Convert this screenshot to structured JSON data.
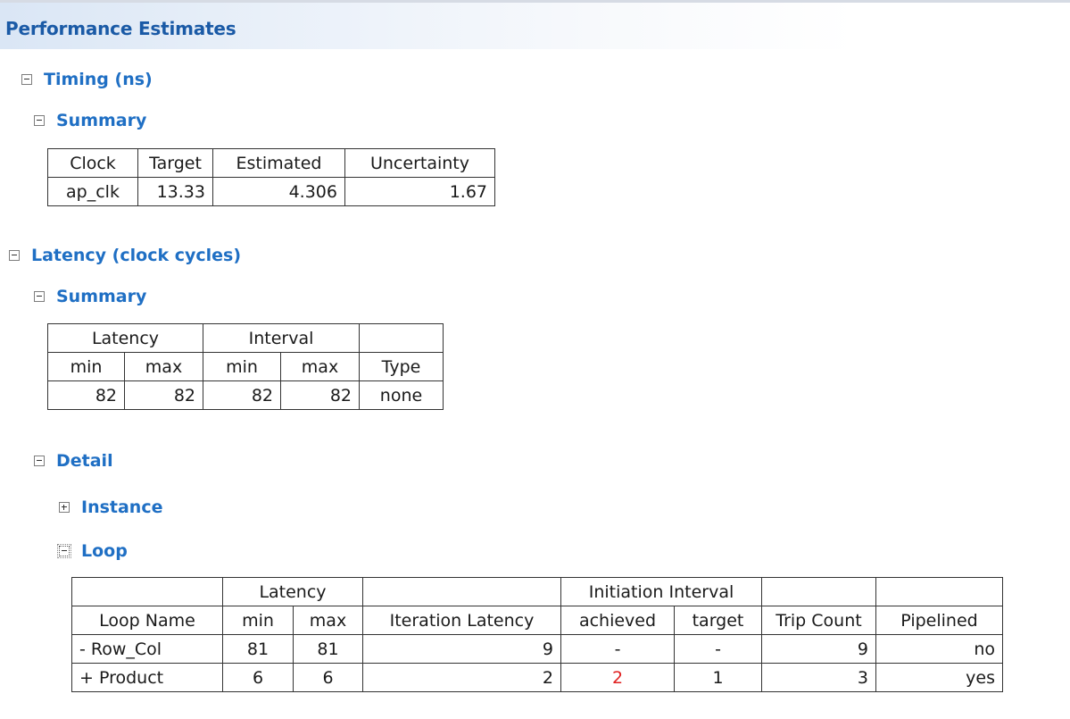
{
  "page_title": "Performance Estimates",
  "timing": {
    "title": "Timing (ns)",
    "summary_title": "Summary",
    "headers": [
      "Clock",
      "Target",
      "Estimated",
      "Uncertainty"
    ],
    "row": [
      "ap_clk",
      "13.33",
      "4.306",
      "1.67"
    ]
  },
  "latency": {
    "title": "Latency (clock cycles)",
    "summary_title": "Summary",
    "group_headers": [
      "Latency",
      "Interval"
    ],
    "headers": [
      "min",
      "max",
      "min",
      "max",
      "Type"
    ],
    "row": [
      "82",
      "82",
      "82",
      "82",
      "none"
    ],
    "detail_title": "Detail",
    "instance_title": "Instance",
    "loop_title": "Loop"
  },
  "loop_table": {
    "group_headers": [
      "Latency",
      "Initiation Interval"
    ],
    "headers": [
      "Loop Name",
      "min",
      "max",
      "Iteration Latency",
      "achieved",
      "target",
      "Trip Count",
      "Pipelined"
    ],
    "rows": [
      [
        "- Row_Col",
        "81",
        "81",
        "9",
        "-",
        "-",
        "9",
        "no"
      ],
      [
        "+ Product",
        "6",
        "6",
        "2",
        "2",
        "1",
        "3",
        "yes"
      ]
    ]
  },
  "colors": {
    "title": "#1a5aa6",
    "section": "#1f6fc4",
    "violation": "#e02020"
  }
}
